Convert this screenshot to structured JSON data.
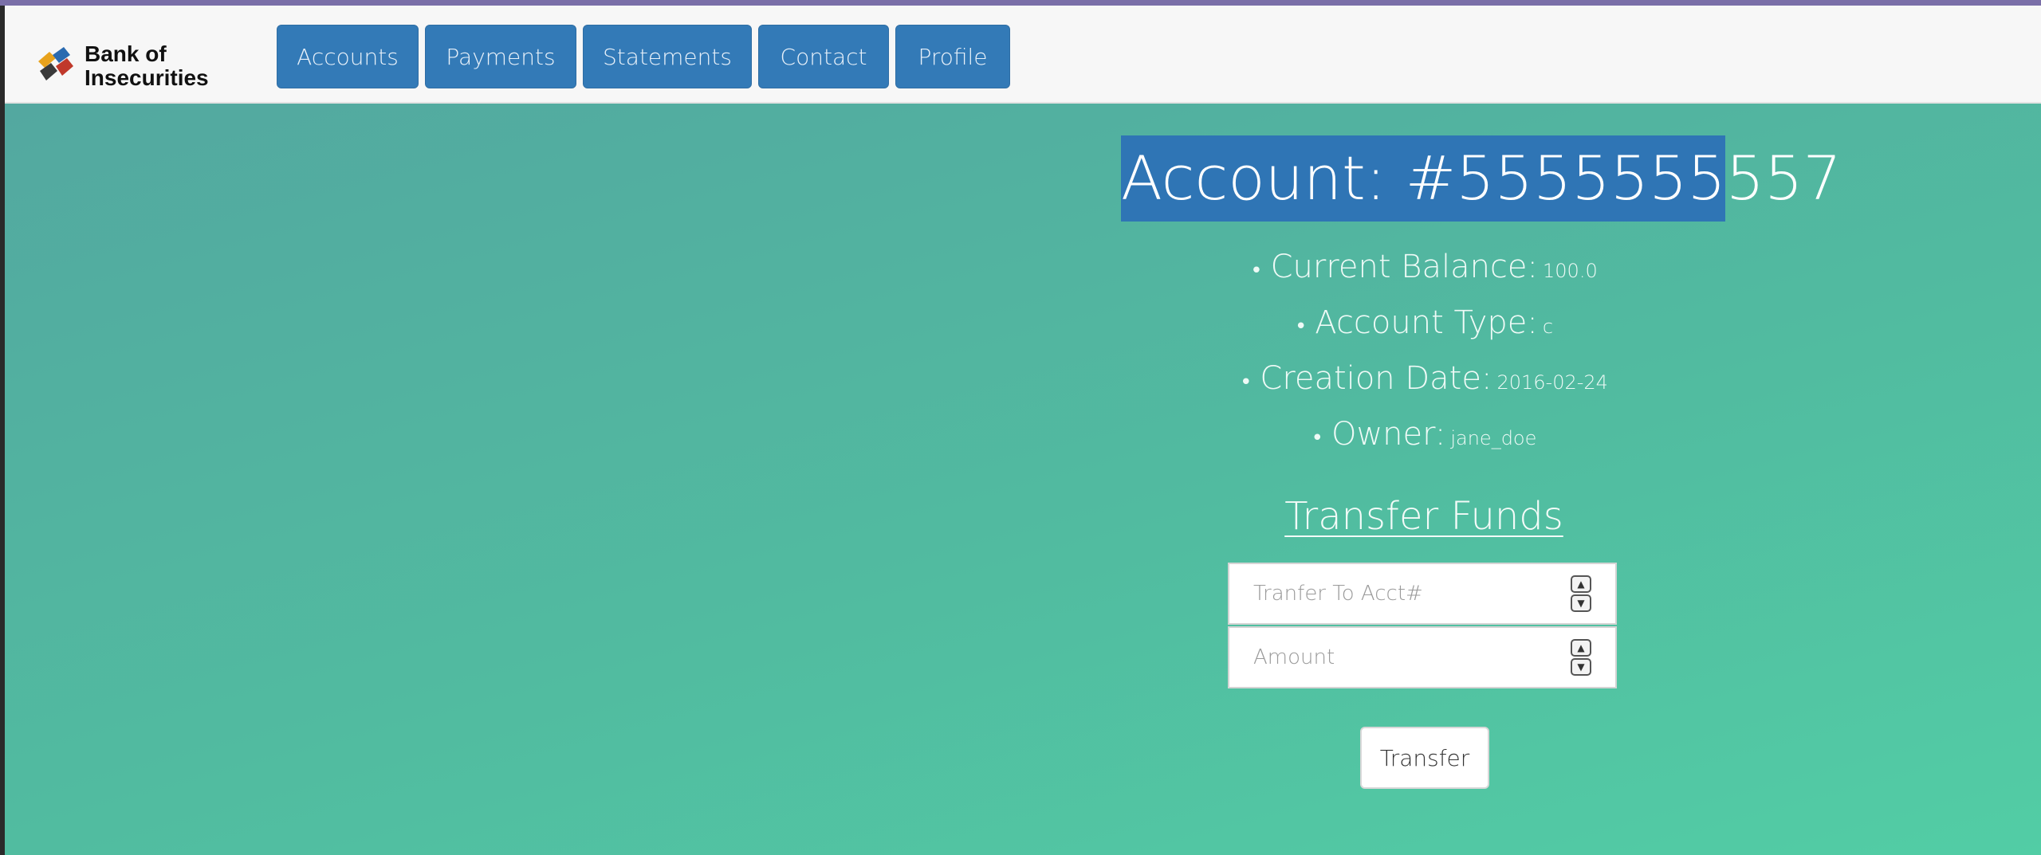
{
  "brand": {
    "name_line1": "Bank of",
    "name_line2": "Insecurities"
  },
  "nav": {
    "items": [
      {
        "label": "Accounts"
      },
      {
        "label": "Payments"
      },
      {
        "label": "Statements"
      },
      {
        "label": "Contact"
      },
      {
        "label": "Profile"
      }
    ]
  },
  "account": {
    "title": "Account: #5555555557",
    "details": [
      {
        "label": "Current Balance:",
        "value": "100.0"
      },
      {
        "label": "Account Type:",
        "value": "c"
      },
      {
        "label": "Creation Date:",
        "value": "2016-02-24"
      },
      {
        "label": "Owner:",
        "value": "jane_doe"
      }
    ]
  },
  "transfer": {
    "heading": "Transfer Funds",
    "to_account_placeholder": "Tranfer To Acct#",
    "amount_placeholder": "Amount",
    "button_label": "Transfer"
  },
  "colors": {
    "nav_button": "#337ab7",
    "title_highlight": "#2f75b5",
    "background_start": "#53a8a0",
    "background_end": "#52cda5"
  }
}
